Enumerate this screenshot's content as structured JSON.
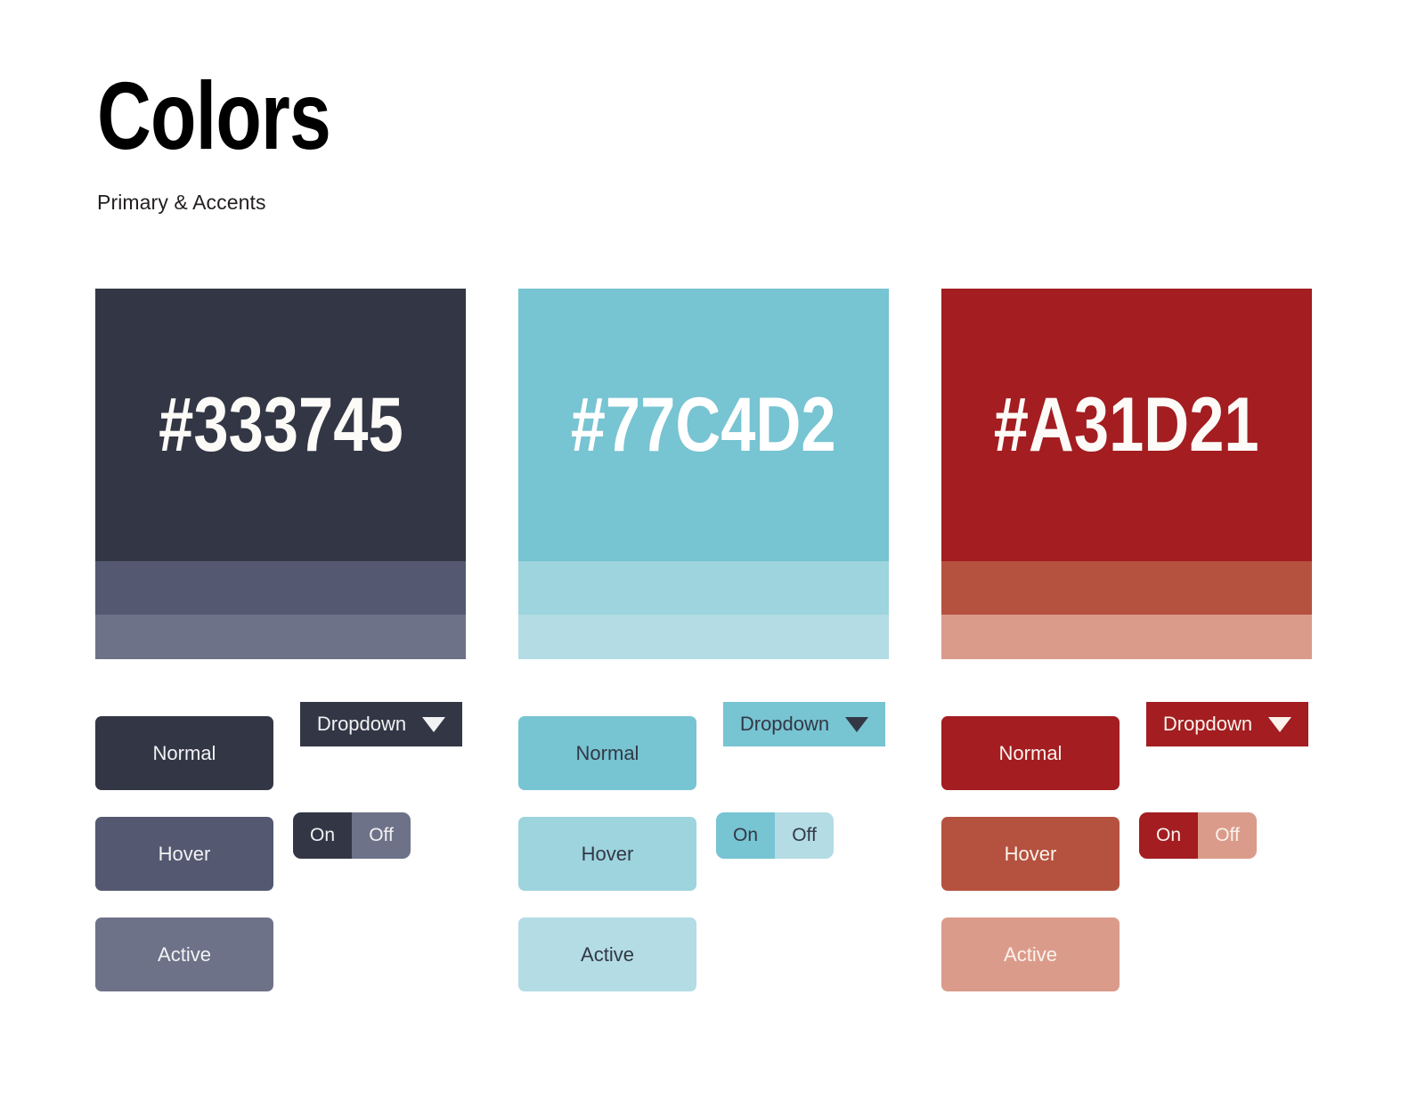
{
  "header": {
    "title": "Colors",
    "subtitle": "Primary & Accents"
  },
  "labels": {
    "normal": "Normal",
    "hover": "Hover",
    "active": "Active",
    "dropdown": "Dropdown",
    "toggle_on": "On",
    "toggle_off": "Off",
    "caret_icon": "chevron-down-icon"
  },
  "background": "#FFFFFF",
  "palettes": [
    {
      "name": "primary-dark",
      "hex": "#333745",
      "base": "#333745",
      "hover": "#545971",
      "active": "#6E7288",
      "hex_text_color": "#FDFBF7",
      "button_text_color": "#F2F2F4",
      "dropdown_text_color": "#F2F2F4",
      "toggle_on_bg": "#333745",
      "toggle_off_bg": "#6E7288",
      "toggle_on_text": "#F2F2F4",
      "toggle_off_text": "#F2F2F4"
    },
    {
      "name": "accent-teal",
      "hex": "#77C4D2",
      "base": "#77C4D2",
      "hover": "#9DD4DE",
      "active": "#B3DCE4",
      "hex_text_color": "#FFFFFF",
      "button_text_color": "#333745",
      "dropdown_text_color": "#333745",
      "toggle_on_bg": "#77C4D2",
      "toggle_off_bg": "#B3DCE4",
      "toggle_on_text": "#333745",
      "toggle_off_text": "#333745"
    },
    {
      "name": "accent-red",
      "hex": "#A31D21",
      "base": "#A31D21",
      "hover": "#B5523F",
      "active": "#DB9B8B",
      "hex_text_color": "#FDFBF7",
      "button_text_color": "#FBF3EC",
      "dropdown_text_color": "#FBF3EC",
      "toggle_on_bg": "#A31D21",
      "toggle_off_bg": "#DB9B8B",
      "toggle_on_text": "#FBF3EC",
      "toggle_off_text": "#FBF3EC"
    }
  ]
}
